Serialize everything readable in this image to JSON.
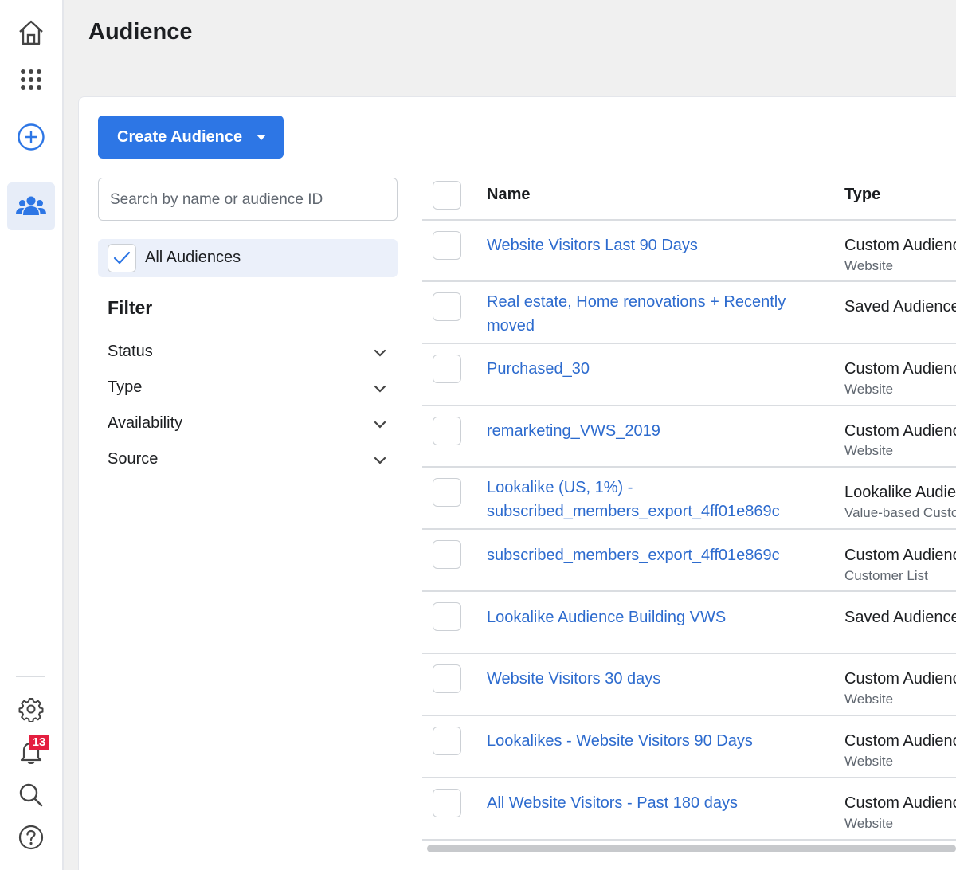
{
  "page": {
    "title": "Audience"
  },
  "rail": {
    "items": [
      {
        "icon": "home-icon"
      },
      {
        "icon": "apps-grid-icon"
      },
      {
        "icon": "add-circle-icon"
      },
      {
        "icon": "audience-people-icon",
        "active": true
      },
      {
        "icon": "settings-gear-icon"
      },
      {
        "icon": "notification-bell-icon",
        "badge": "13"
      },
      {
        "icon": "search-icon"
      },
      {
        "icon": "help-icon"
      }
    ],
    "notification_count": "13"
  },
  "toolbar": {
    "create_label": "Create Audience"
  },
  "search": {
    "placeholder": "Search by name or audience ID",
    "value": ""
  },
  "all_audiences": {
    "label": "All Audiences",
    "checked": true
  },
  "filter": {
    "title": "Filter",
    "items": [
      {
        "label": "Status"
      },
      {
        "label": "Type"
      },
      {
        "label": "Availability"
      },
      {
        "label": "Source"
      }
    ]
  },
  "table": {
    "columns": {
      "name": "Name",
      "type": "Type"
    },
    "rows": [
      {
        "name": "Website Visitors Last 90 Days",
        "type": "Custom Audience",
        "subtype": "Website"
      },
      {
        "name": "Real estate, Home renovations + Recently moved",
        "type": "Saved Audience",
        "subtype": ""
      },
      {
        "name": "Purchased_30",
        "type": "Custom Audience",
        "subtype": "Website"
      },
      {
        "name": "remarketing_VWS_2019",
        "type": "Custom Audience",
        "subtype": "Website"
      },
      {
        "name": "Lookalike (US, 1%) - subscribed_members_export_4ff01e869c",
        "type": "Lookalike Audience",
        "subtype": "Value-based Custom Audience"
      },
      {
        "name": "subscribed_members_export_4ff01e869c",
        "type": "Custom Audience",
        "subtype": "Customer List"
      },
      {
        "name": "Lookalike Audience Building VWS",
        "type": "Saved Audience",
        "subtype": ""
      },
      {
        "name": "Website Visitors 30 days",
        "type": "Custom Audience",
        "subtype": "Website"
      },
      {
        "name": "Lookalikes - Website Visitors 90 Days",
        "type": "Custom Audience",
        "subtype": "Website"
      },
      {
        "name": "All Website Visitors - Past 180 days",
        "type": "Custom Audience",
        "subtype": "Website"
      }
    ]
  },
  "colors": {
    "accent": "#2d76e5",
    "link": "#2d6bce",
    "badge": "#e41e3f"
  }
}
